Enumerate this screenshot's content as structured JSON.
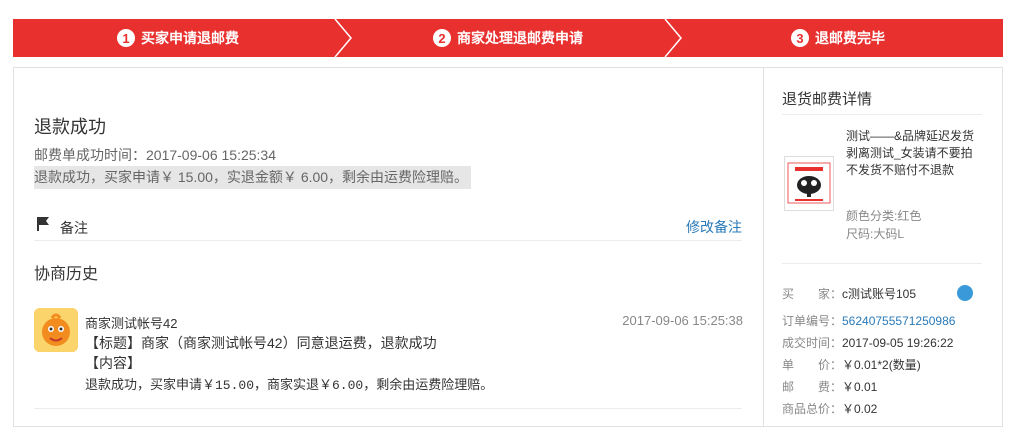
{
  "steps": [
    {
      "num": "1",
      "label": "买家申请退邮费"
    },
    {
      "num": "2",
      "label": "商家处理退邮费申请"
    },
    {
      "num": "3",
      "label": "退邮费完毕"
    }
  ],
  "main": {
    "title": "退款成功",
    "time_line": "邮费单成功时间：2017-09-06 15:25:34",
    "result_line": "退款成功，买家申请￥ 15.00，实退金额￥ 6.00，剩余由运费险理赔。",
    "note_label": "备注",
    "edit_note": "修改备注",
    "history_title": "协商历史",
    "message": {
      "author": "商家测试帐号42",
      "time": "2017-09-06 15:25:38",
      "line1": "【标题】商家（商家测试帐号42）同意退运费，退款成功",
      "line2": "【内容】",
      "line3": "退款成功，买家申请￥15.00，商家实退￥6.00，剩余由运费险理赔。"
    }
  },
  "sidebar": {
    "title": "退货邮费详情",
    "product": {
      "name": "测试——&品牌延迟发货剥离测试_女装请不要拍不发货不赔付不退款",
      "color": "颜色分类:红色",
      "size": "尺码:大码L"
    },
    "info": {
      "buyer_label": "买　　家：",
      "buyer": "c测试账号105",
      "order_label": "订单编号：",
      "order": "56240755571250986",
      "deal_label": "成交时间：",
      "deal": "2017-09-05 19:26:22",
      "price_label": "单　　价：",
      "price": "￥0.01*2(数量)",
      "postage_label": "邮　　费：",
      "postage": "￥0.01",
      "total_label": "商品总价：",
      "total": "￥0.02"
    }
  },
  "colors": {
    "accent": "#e8302f",
    "link": "#2a7ab8"
  }
}
